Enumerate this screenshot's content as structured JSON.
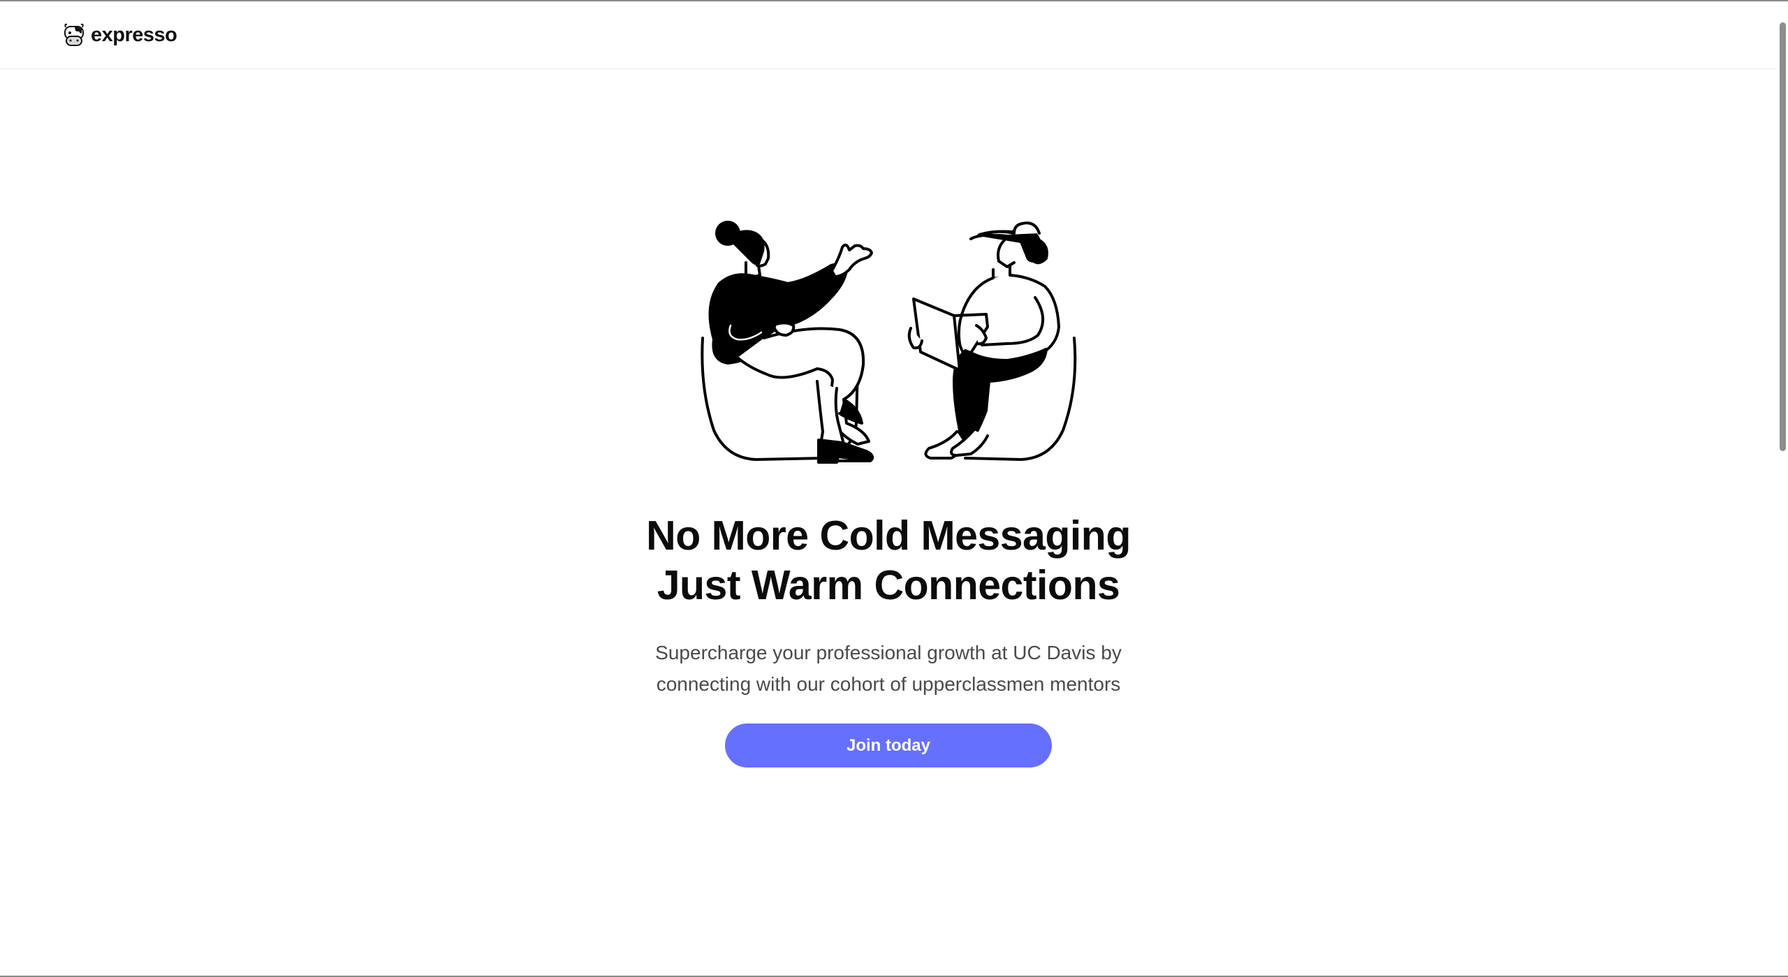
{
  "header": {
    "brand_name": "expresso",
    "logo_icon": "cow-icon"
  },
  "hero": {
    "illustration": "two-people-conversation-illustration",
    "headline_line1": "No More Cold Messaging",
    "headline_line2": "Just Warm Connections",
    "subtext_line1": "Supercharge your professional growth at UC Davis by",
    "subtext_line2": "connecting with our cohort of upperclassmen mentors",
    "cta_label": "Join today"
  },
  "colors": {
    "accent": "#6670ff",
    "text_primary": "#0b0b0b",
    "text_secondary": "#4a4a4a",
    "background": "#ffffff"
  }
}
